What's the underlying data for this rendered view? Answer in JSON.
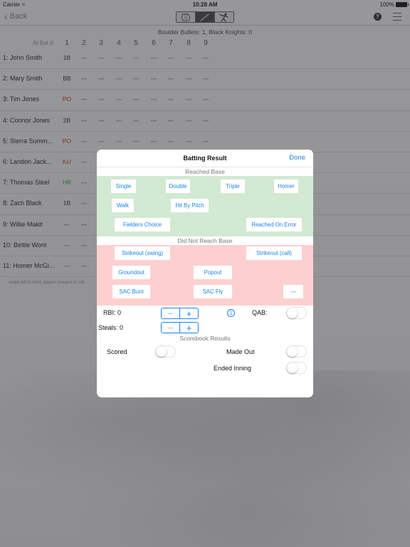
{
  "status_bar": {
    "carrier": "Carrier",
    "wifi_icon": "wifi-icon",
    "time": "10:28 AM",
    "battery": "100%"
  },
  "nav": {
    "back_label": "Back",
    "segments": [
      {
        "icon": "glove-icon",
        "active": false
      },
      {
        "icon": "bat-icon",
        "active": true
      },
      {
        "icon": "pitcher-icon",
        "active": false
      }
    ],
    "help_icon": "?",
    "menu_icon": "hamburger-menu-icon"
  },
  "scoreboard": {
    "text": "Boulder Bullets: 1, Black Knights: 0"
  },
  "at_bat_header": {
    "label": "At Bat #:",
    "columns": [
      "1",
      "2",
      "3",
      "4",
      "5",
      "6",
      "7",
      "8",
      "9"
    ]
  },
  "lineup": [
    {
      "name": "1: John Smith",
      "results": [
        {
          "v": "1B",
          "c": ""
        },
        {
          "v": "---"
        },
        {
          "v": "---"
        },
        {
          "v": "---"
        },
        {
          "v": "---"
        },
        {
          "v": "---"
        },
        {
          "v": "---"
        },
        {
          "v": "---"
        },
        {
          "v": "---"
        }
      ]
    },
    {
      "name": "2: Mary Smith",
      "results": [
        {
          "v": "BB",
          "c": ""
        },
        {
          "v": "---"
        },
        {
          "v": "---"
        },
        {
          "v": "---"
        },
        {
          "v": "---"
        },
        {
          "v": "---"
        },
        {
          "v": "---"
        },
        {
          "v": "---"
        },
        {
          "v": "---"
        }
      ]
    },
    {
      "name": "3: Tim Jones",
      "results": [
        {
          "v": "PO",
          "c": "red"
        },
        {
          "v": "---"
        },
        {
          "v": "---"
        },
        {
          "v": "---"
        },
        {
          "v": "---"
        },
        {
          "v": "---"
        },
        {
          "v": "---"
        },
        {
          "v": "---"
        },
        {
          "v": "---"
        }
      ]
    },
    {
      "name": "4: Connor Jones",
      "results": [
        {
          "v": "2B",
          "c": ""
        },
        {
          "v": "---"
        },
        {
          "v": "---"
        },
        {
          "v": "---"
        },
        {
          "v": "---"
        },
        {
          "v": "---"
        },
        {
          "v": "---"
        },
        {
          "v": "---"
        },
        {
          "v": "---"
        }
      ]
    },
    {
      "name": "5: Sierra Summ...",
      "results": [
        {
          "v": "PO",
          "c": "red"
        },
        {
          "v": "---"
        },
        {
          "v": "---"
        },
        {
          "v": "---"
        },
        {
          "v": "---"
        },
        {
          "v": "---"
        },
        {
          "v": "---"
        },
        {
          "v": "---"
        },
        {
          "v": "---"
        }
      ]
    },
    {
      "name": "6: Landon Jack...",
      "results": [
        {
          "v": "Kc/",
          "c": "red"
        },
        {
          "v": "---"
        },
        {
          "v": "---"
        },
        {
          "v": "---"
        },
        {
          "v": "---"
        },
        {
          "v": "---"
        },
        {
          "v": "---"
        },
        {
          "v": "---"
        },
        {
          "v": "---"
        }
      ]
    },
    {
      "name": "7: Thomas Steel",
      "results": [
        {
          "v": "HR",
          "c": "green"
        },
        {
          "v": "---"
        },
        {
          "v": "---"
        },
        {
          "v": "---"
        },
        {
          "v": "---"
        },
        {
          "v": "---"
        },
        {
          "v": "---"
        },
        {
          "v": "---"
        },
        {
          "v": "---"
        }
      ]
    },
    {
      "name": "8: Zach Black",
      "results": [
        {
          "v": "1B",
          "c": ""
        },
        {
          "v": "---"
        },
        {
          "v": "---"
        },
        {
          "v": "---"
        },
        {
          "v": "---"
        },
        {
          "v": "---"
        },
        {
          "v": "---"
        },
        {
          "v": "---"
        },
        {
          "v": "---"
        }
      ]
    },
    {
      "name": "9: Willie Makit",
      "results": [
        {
          "v": "---"
        },
        {
          "v": "---"
        },
        {
          "v": "---"
        },
        {
          "v": "---"
        },
        {
          "v": "---"
        },
        {
          "v": "---"
        },
        {
          "v": "---"
        },
        {
          "v": "---"
        },
        {
          "v": "---"
        }
      ]
    },
    {
      "name": "10: Bettie Wont",
      "results": [
        {
          "v": "---"
        },
        {
          "v": "---"
        },
        {
          "v": "---"
        },
        {
          "v": "---"
        },
        {
          "v": "---"
        },
        {
          "v": "---"
        },
        {
          "v": "---"
        },
        {
          "v": "---"
        },
        {
          "v": "---"
        }
      ]
    },
    {
      "name": "11: Homer McGi...",
      "results": [
        {
          "v": "---"
        },
        {
          "v": "---"
        },
        {
          "v": "---"
        },
        {
          "v": "---"
        },
        {
          "v": "---"
        },
        {
          "v": "---"
        },
        {
          "v": "---"
        },
        {
          "v": "---"
        },
        {
          "v": "---"
        }
      ]
    }
  ],
  "hint": "swipe left to mark players present or not",
  "modal": {
    "title": "Batting Result",
    "done_label": "Done",
    "reached_base": {
      "label": "Reached Base",
      "color": "#d2e9d2",
      "buttons": [
        "Single",
        "Double",
        "Triple",
        "Homer",
        "Walk",
        "Hit By Pitch",
        "Fielders Choice",
        "Reached On Error"
      ]
    },
    "did_not_reach": {
      "label": "Did Not Reach Base",
      "color": "#fdd0d0",
      "buttons": [
        "Strikeout (swing)",
        "Strikeout (call)",
        "Groundout",
        "Popout",
        "SAC Bunt",
        "SAC Fly",
        "---"
      ]
    },
    "rbi": {
      "label": "RBI: 0",
      "minus": "−",
      "plus": "+"
    },
    "steals": {
      "label": "Steals: 0",
      "minus": "−",
      "plus": "+"
    },
    "info_icon": "i",
    "qab": {
      "label": "QAB:",
      "on": false
    },
    "scorebook": {
      "label": "Scorebook Results",
      "scored": {
        "label": "Scored",
        "on": false
      },
      "made_out": {
        "label": "Made Out",
        "on": false
      },
      "ended_inning": {
        "label": "Ended Inning",
        "on": false
      }
    }
  },
  "colors": {
    "accent": "#1a82f0",
    "out_red": "#d01818",
    "hit_green": "#1c9a2a"
  }
}
